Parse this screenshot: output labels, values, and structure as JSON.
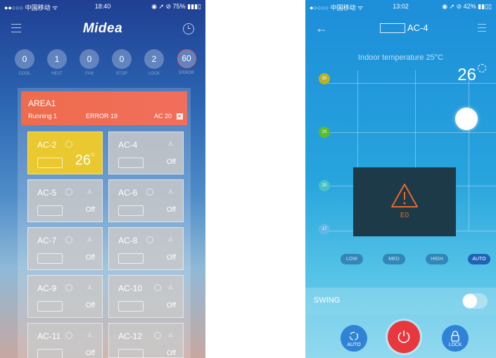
{
  "phone1": {
    "status": {
      "carrier": "●●○○○ 中国移动 ᯤ",
      "time": "18:40",
      "battery": "◉ ➚ ⊘ 75% ▮▮▮▯"
    },
    "nav": {
      "logo": "Midea"
    },
    "counters": [
      {
        "value": "0",
        "label": "COOL"
      },
      {
        "value": "1",
        "label": "HEAT"
      },
      {
        "value": "0",
        "label": "FAN"
      },
      {
        "value": "0",
        "label": "STOP"
      },
      {
        "value": "2",
        "label": "LOCK"
      },
      {
        "value": "60",
        "label": "ERROR"
      }
    ],
    "area": {
      "title": "AREA1",
      "running": "Running 1",
      "error": "ERROR 19",
      "ac": "AC 20"
    },
    "units": [
      {
        "name": "AC-2",
        "value": "26",
        "unit": "°C",
        "active": true
      },
      {
        "name": "AC-4",
        "value": "Off"
      },
      {
        "name": "AC-5",
        "value": "Off"
      },
      {
        "name": "AC-6",
        "value": "Off"
      },
      {
        "name": "AC-7",
        "value": "Off"
      },
      {
        "name": "AC-8",
        "value": "Off"
      },
      {
        "name": "AC-9",
        "value": "Off"
      },
      {
        "name": "AC-10",
        "value": "Off"
      },
      {
        "name": "AC-11",
        "value": "Off"
      },
      {
        "name": "AC-12",
        "value": "Off"
      }
    ]
  },
  "phone2": {
    "status": {
      "carrier": "●○○○○ 中国移动 ᯤ",
      "time": "13:02",
      "battery": "◉ ➚ ⊘ 42% ▮▮▯▯"
    },
    "nav": {
      "title": "AC-4"
    },
    "indoor": "Indoor temperature 25°C",
    "setpoint": "26",
    "scale": [
      {
        "value": "30",
        "color": "#b9b21e"
      },
      {
        "value": "25",
        "color": "#5cbc2a"
      },
      {
        "value": "20",
        "color": "#47c1c5"
      },
      {
        "value": "17",
        "color": "#5fb8e6"
      }
    ],
    "error_code": "E0",
    "fan_speeds": [
      {
        "label": "LOW",
        "selected": false
      },
      {
        "label": "MED",
        "selected": false
      },
      {
        "label": "HIGH",
        "selected": false
      },
      {
        "label": "AUTO",
        "selected": true
      }
    ],
    "swing_label": "SWING",
    "swing_on": false,
    "buttons": {
      "mode": "AUTO",
      "lock": "LOCK"
    },
    "colors": {
      "power": "#e8373d",
      "accent_blue": "#2f83d6",
      "error": "#e9682d"
    }
  }
}
